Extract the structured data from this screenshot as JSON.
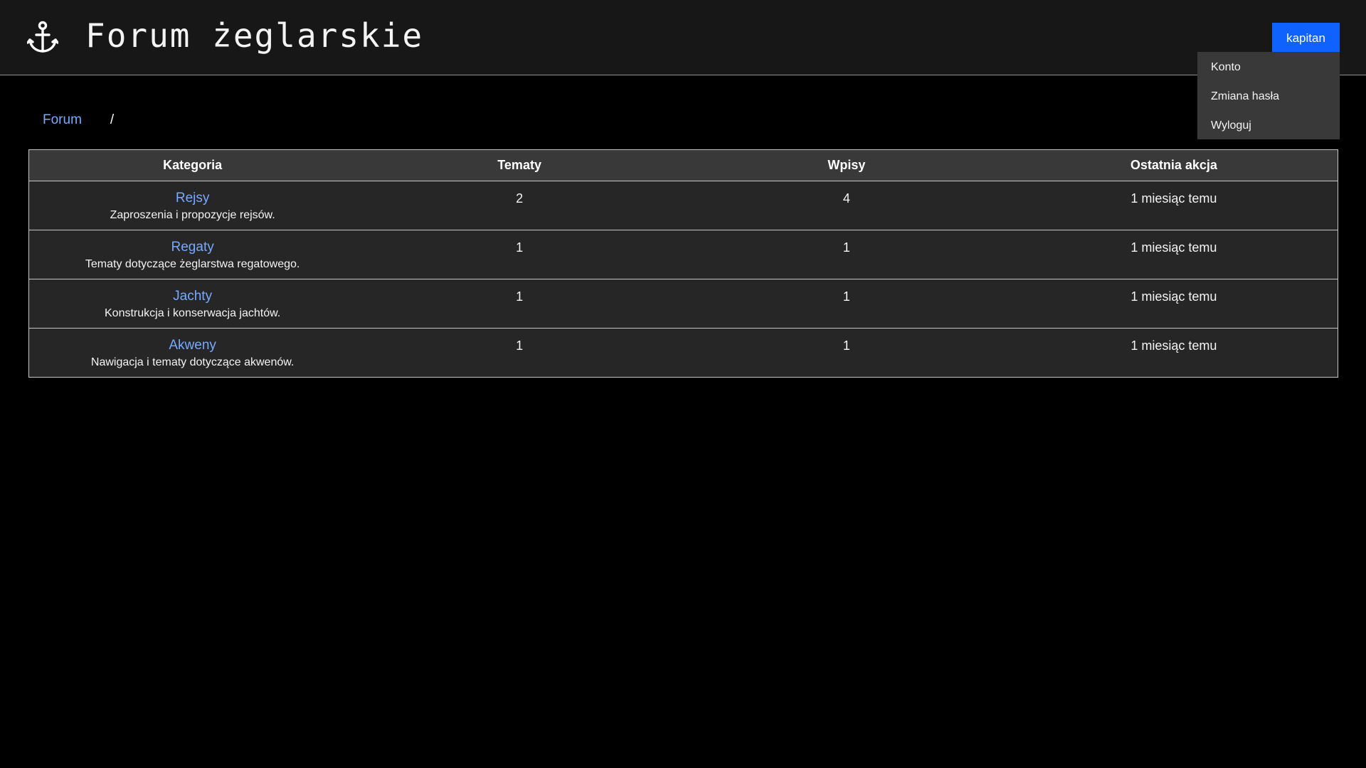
{
  "header": {
    "title": "Forum żeglarskie",
    "logo_icon": "anchor-icon",
    "user_button": "kapitan",
    "accent_color": "#0f62fe"
  },
  "user_menu": {
    "items": [
      {
        "label": "Konto"
      },
      {
        "label": "Zmiana hasła"
      },
      {
        "label": "Wyloguj"
      }
    ]
  },
  "breadcrumb": {
    "root": "Forum",
    "separator": "/"
  },
  "table": {
    "headers": {
      "category": "Kategoria",
      "topics": "Tematy",
      "posts": "Wpisy",
      "last_action": "Ostatnia akcja"
    },
    "rows": [
      {
        "name": "Rejsy",
        "description": "Zaproszenia i propozycje rejsów.",
        "topics": "2",
        "posts": "4",
        "last_action": "1 miesiąc temu"
      },
      {
        "name": "Regaty",
        "description": "Tematy dotyczące żeglarstwa regatowego.",
        "topics": "1",
        "posts": "1",
        "last_action": "1 miesiąc temu"
      },
      {
        "name": "Jachty",
        "description": "Konstrukcja i konserwacja jachtów.",
        "topics": "1",
        "posts": "1",
        "last_action": "1 miesiąc temu"
      },
      {
        "name": "Akweny",
        "description": "Nawigacja i tematy dotyczące akwenów.",
        "topics": "1",
        "posts": "1",
        "last_action": "1 miesiąc temu"
      }
    ]
  }
}
